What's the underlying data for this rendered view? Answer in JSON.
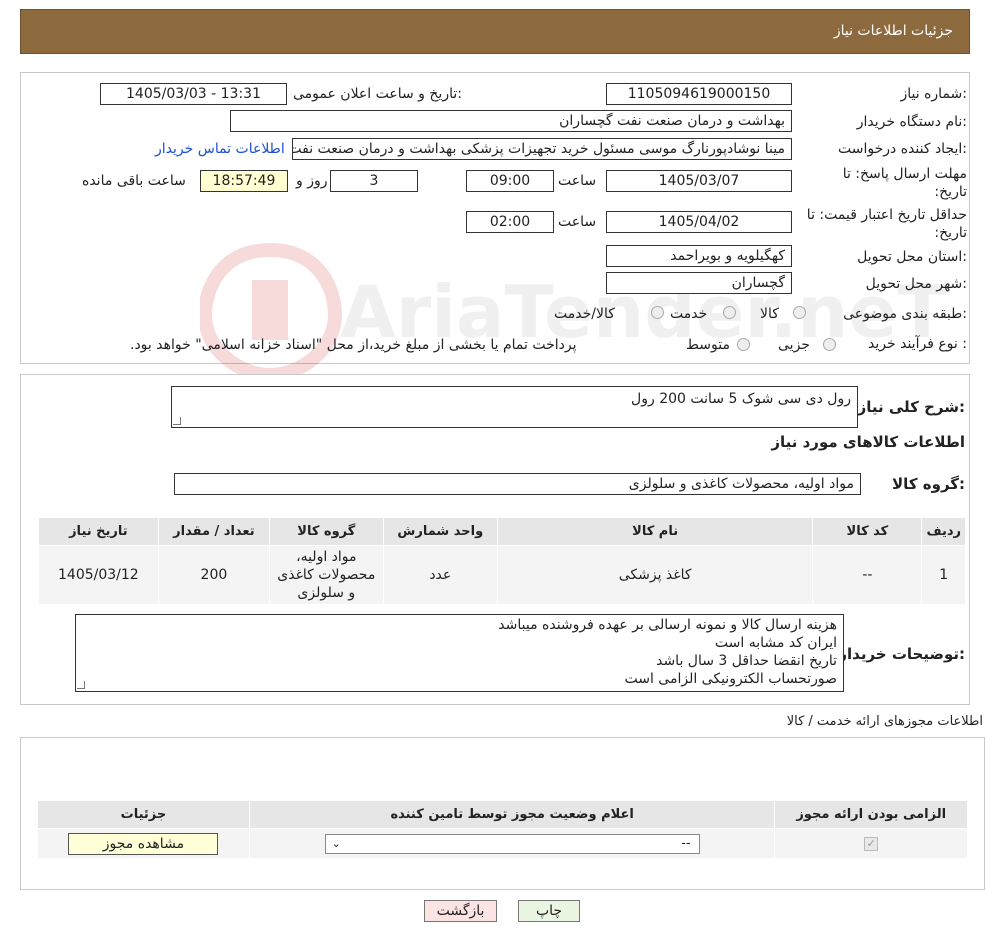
{
  "header": {
    "title": "جزئیات اطلاعات نیاز"
  },
  "form": {
    "need_number_label": "شماره نیاز:",
    "need_number": "1105094619000150",
    "announce_label": "تاریخ و ساعت اعلان عمومی:",
    "announce_value": "1405/03/03 - 13:31",
    "buyer_org_label": "نام دستگاه خریدار:",
    "buyer_org": "بهداشت و درمان صنعت نفت گچساران",
    "creator_label": "ایجاد کننده درخواست:",
    "creator": "مینا نوشادپورنارگ موسی مسئول خرید تجهیزات پزشکی  بهداشت و درمان صنعت نفت گچساران",
    "contact_link": "اطلاعات تماس خریدار",
    "deadline_label_1": "مهلت ارسال پاسخ: تا",
    "deadline_label_2": "تاریخ:",
    "deadline_date": "1405/03/07",
    "time_label": "ساعت",
    "deadline_time": "09:00",
    "days_count": "3",
    "days_label": "روز و",
    "remaining_time": "18:57:49",
    "remaining_label": "ساعت باقی مانده",
    "validity_label_1": "حداقل تاریخ اعتبار قیمت: تا",
    "validity_label_2": "تاریخ:",
    "validity_date": "1405/04/02",
    "validity_time": "02:00",
    "province_label": "استان محل تحویل:",
    "province": "کهگیلویه و بویراحمد",
    "city_label": "شهر محل تحویل:",
    "city": "گچساران",
    "category_label": "طبقه بندی موضوعی:",
    "category_options": [
      "کالا",
      "خدمت",
      "کالا/خدمت"
    ],
    "process_label": "نوع فرآیند خرید :",
    "process_options": [
      "جزیی",
      "متوسط"
    ],
    "process_note": "پرداخت تمام یا بخشی از مبلغ خرید،از محل \"اسناد خزانه اسلامی\" خواهد بود."
  },
  "description": {
    "label": "شرح کلی نیاز:",
    "value": "رول دی سی شوک 5 سانت 200 رول"
  },
  "goods": {
    "section_title": "اطلاعات کالاهای مورد نیاز",
    "group_label": "گروه کالا:",
    "group_value": "مواد اولیه، محصولات کاغذی و سلولزی",
    "columns": [
      "ردیف",
      "کد کالا",
      "نام کالا",
      "واحد شمارش",
      "گروه کالا",
      "تعداد / مقدار",
      "تاریخ نیاز"
    ],
    "rows": [
      [
        "1",
        "--",
        "کاغذ پزشکی",
        "عدد",
        "مواد اولیه، محصولات کاغذی و سلولزی",
        "200",
        "1405/03/12"
      ]
    ]
  },
  "buyer_notes": {
    "label": "توضیحات خریدار:",
    "lines": [
      "هزینه ارسال کالا و نمونه ارسالی بر عهده فروشنده میباشد",
      "ایران کد مشابه است",
      "تاریخ انقضا حداقل 3 سال باشد",
      "صورتحساب الکترونیکی الزامی است"
    ]
  },
  "permits": {
    "section_title": "اطلاعات مجوزهای ارائه خدمت / کالا",
    "columns": [
      "الزامی بودن ارائه مجوز",
      "اعلام وضعیت مجوز توسط تامین کننده",
      "جزئیات"
    ],
    "select_value": "--",
    "view_button": "مشاهده مجوز"
  },
  "actions": {
    "print": "چاپ",
    "back": "بازگشت"
  },
  "watermark": "AriaTender.neT"
}
